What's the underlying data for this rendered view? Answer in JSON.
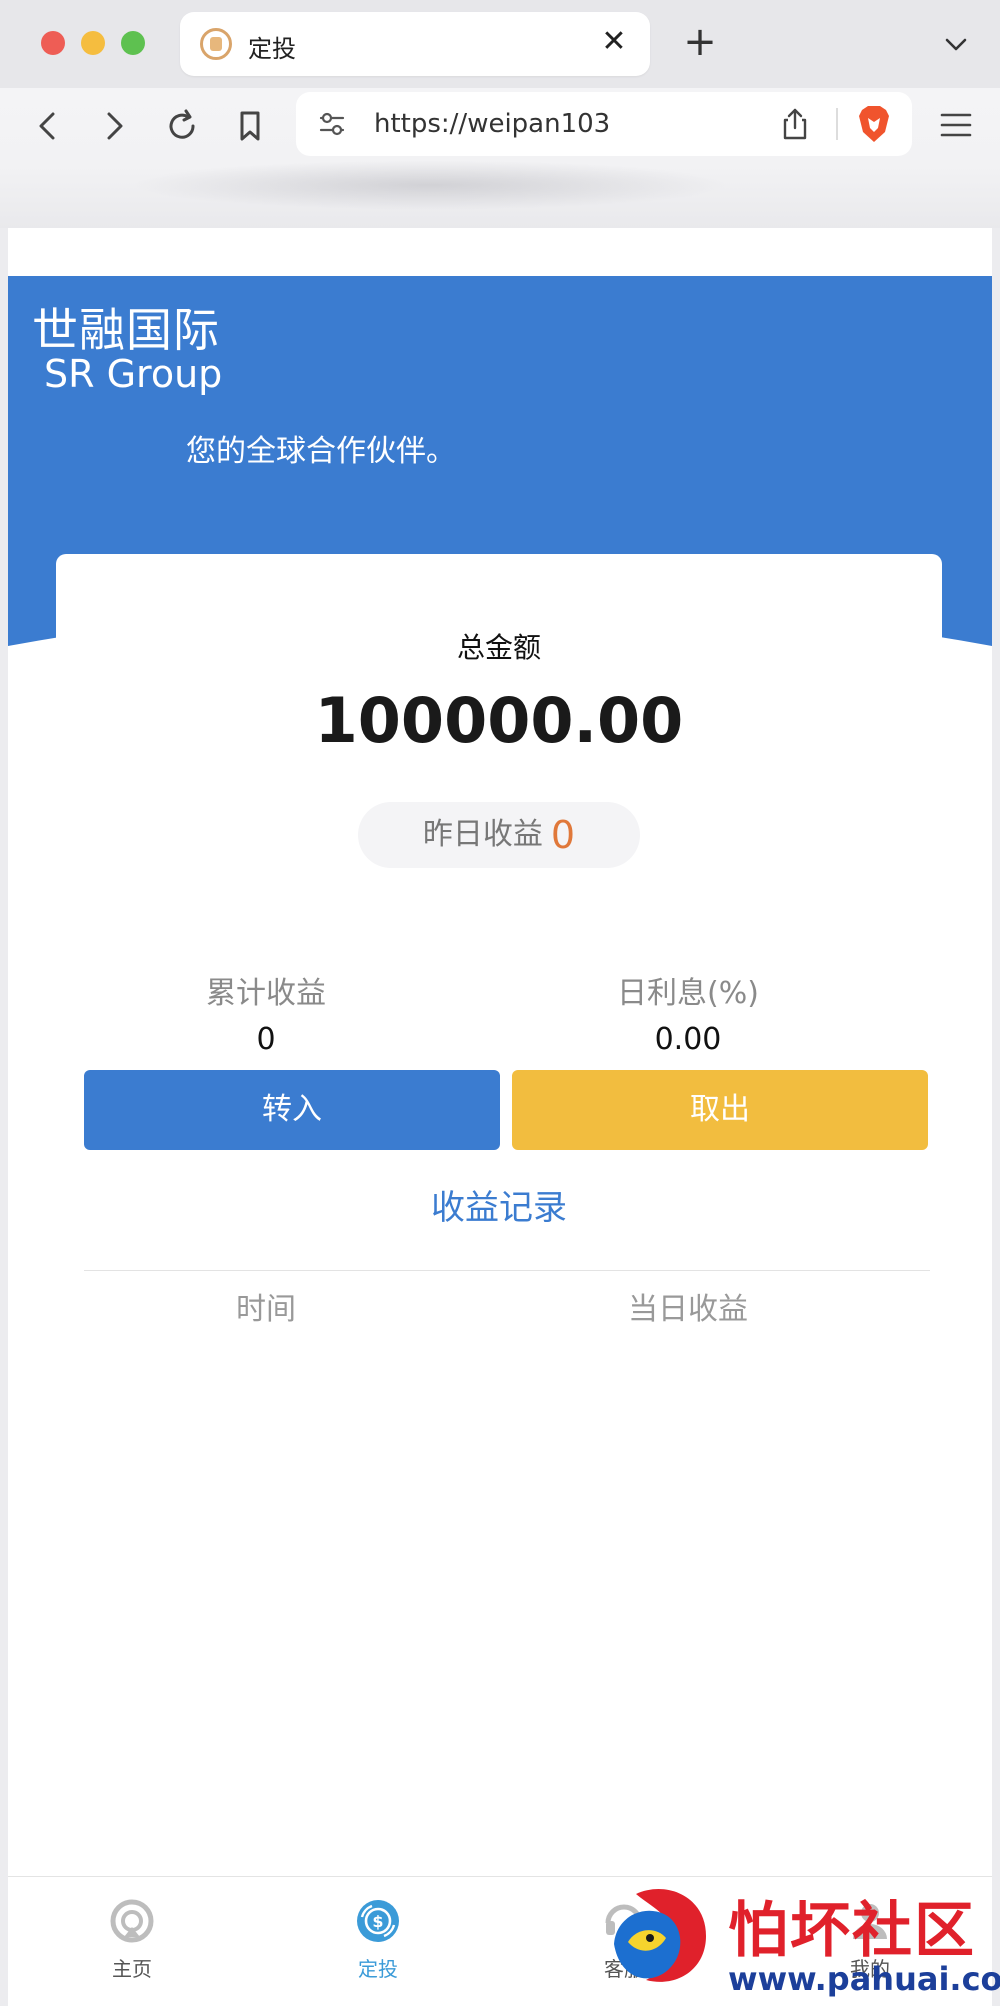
{
  "browser": {
    "tab_title": "定投",
    "tab_close": "✕",
    "new_tab": "+",
    "url": "https://weipan103"
  },
  "header": {
    "brand_cn": "世融国际",
    "brand_en": "SR Group",
    "slogan": "您的全球合作伙伴。",
    "accent_color": "#3b7cd0"
  },
  "summary": {
    "total_label": "总金额",
    "total_value": "100000.00",
    "yesterday_label": "昨日收益",
    "yesterday_value": "0",
    "cumulative_label": "累计收益",
    "cumulative_value": "0",
    "daily_rate_label": "日利息(%)",
    "daily_rate_value": "0.00"
  },
  "actions": {
    "deposit_label": "转入",
    "withdraw_label": "取出"
  },
  "records": {
    "title": "收益记录",
    "columns": [
      "时间",
      "当日收益"
    ],
    "rows": []
  },
  "bottom_nav": {
    "items": [
      {
        "label": "主页",
        "icon": "home-icon",
        "active": false
      },
      {
        "label": "定投",
        "icon": "invest-icon",
        "active": true
      },
      {
        "label": "客服",
        "icon": "service-icon",
        "active": false
      },
      {
        "label": "我的",
        "icon": "profile-icon",
        "active": false
      }
    ]
  },
  "watermark": {
    "text_cn": "怕坏社区",
    "url": "www.pahuai.com"
  }
}
